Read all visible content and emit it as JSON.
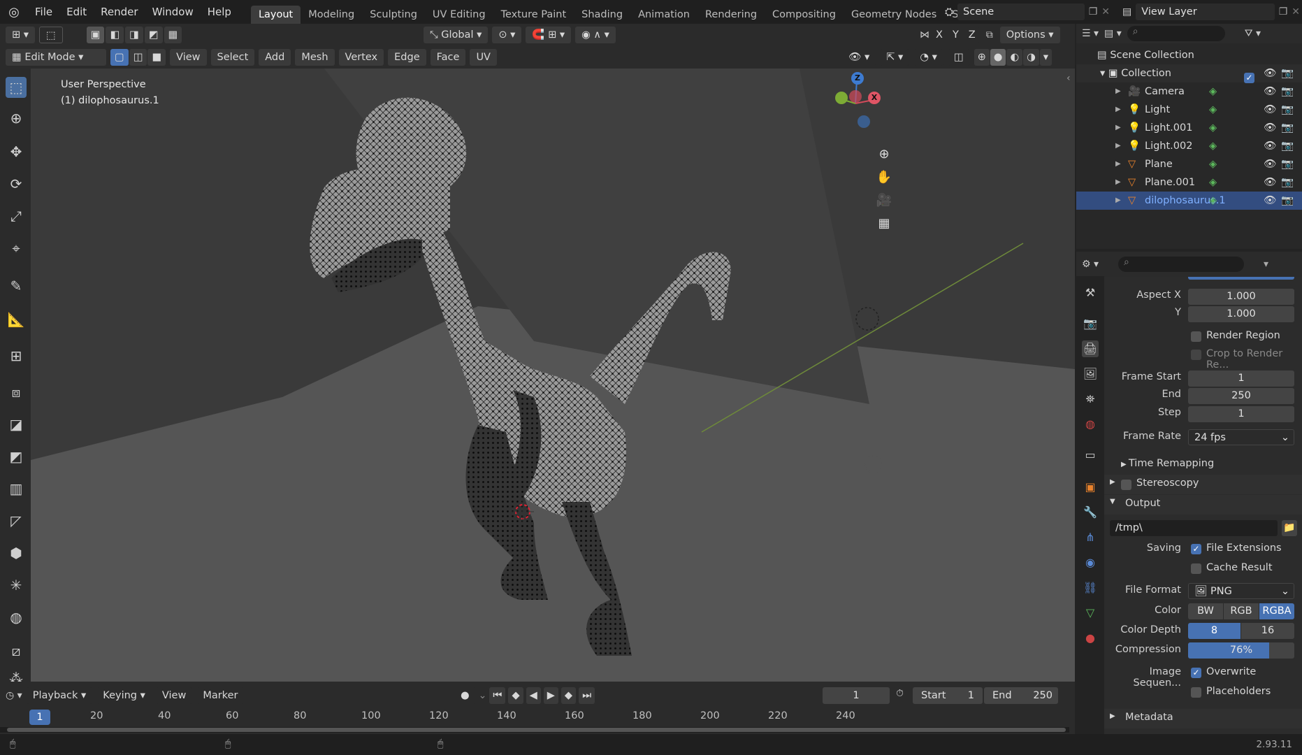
{
  "topbar": {
    "menus": [
      "File",
      "Edit",
      "Render",
      "Window",
      "Help"
    ],
    "workspaces": [
      "Layout",
      "Modeling",
      "Sculpting",
      "UV Editing",
      "Texture Paint",
      "Shading",
      "Animation",
      "Rendering",
      "Compositing",
      "Geometry Nodes",
      "Scripting"
    ],
    "active_workspace": "Layout",
    "scene": "Scene",
    "view_layer": "View Layer"
  },
  "viewport_header": {
    "transform_orientation": "Global",
    "axes": [
      "X",
      "Y",
      "Z"
    ],
    "options_label": "Options",
    "mode": "Edit Mode",
    "menus": [
      "View",
      "Select",
      "Add",
      "Mesh",
      "Vertex",
      "Edge",
      "Face",
      "UV"
    ]
  },
  "viewport": {
    "perspective_label": "User Perspective",
    "object_label": "(1) dilophosaurus.1",
    "gizmo_axes": {
      "z": "Z",
      "x": "X"
    }
  },
  "outliner": {
    "root": "Scene Collection",
    "collection": "Collection",
    "items": [
      {
        "name": "Camera"
      },
      {
        "name": "Light"
      },
      {
        "name": "Light.001"
      },
      {
        "name": "Light.002"
      },
      {
        "name": "Plane"
      },
      {
        "name": "Plane.001"
      },
      {
        "name": "dilophosaurus.1",
        "selected": true
      }
    ]
  },
  "properties": {
    "aspect_x_label": "Aspect X",
    "aspect_x": "1.000",
    "aspect_y_label": "Y",
    "aspect_y": "1.000",
    "render_region": "Render Region",
    "crop_region": "Crop to Render Re...",
    "frame_start_label": "Frame Start",
    "frame_start": "1",
    "end_label": "End",
    "end": "250",
    "step_label": "Step",
    "step": "1",
    "frame_rate_label": "Frame Rate",
    "frame_rate": "24 fps",
    "time_remapping": "Time Remapping",
    "stereoscopy": "Stereoscopy",
    "output": "Output",
    "output_path": "/tmp\\",
    "saving_label": "Saving",
    "file_extensions": "File Extensions",
    "cache_result": "Cache Result",
    "file_format_label": "File Format",
    "file_format": "PNG",
    "color_label": "Color",
    "color_options": [
      "BW",
      "RGB",
      "RGBA"
    ],
    "color_active": "RGBA",
    "color_depth_label": "Color Depth",
    "color_depth_options": [
      "8",
      "16"
    ],
    "compression_label": "Compression",
    "compression": "76%",
    "compression_value": 0.76,
    "image_sequence_label": "Image Sequen...",
    "overwrite": "Overwrite",
    "placeholders": "Placeholders",
    "metadata": "Metadata"
  },
  "timeline": {
    "menus": [
      "Playback",
      "Keying",
      "View",
      "Marker"
    ],
    "current_frame": "1",
    "start_label": "Start",
    "start": "1",
    "end_label": "End",
    "end": "250",
    "ticks": [
      "20",
      "40",
      "60",
      "80",
      "100",
      "120",
      "140",
      "160",
      "180",
      "200",
      "220",
      "240"
    ],
    "playhead": "1"
  },
  "status": {
    "version": "2.93.11"
  },
  "colors": {
    "accent": "#4772b3",
    "selected_text": "#7fb0ff",
    "viewport_bg": "#3a3a3a"
  }
}
